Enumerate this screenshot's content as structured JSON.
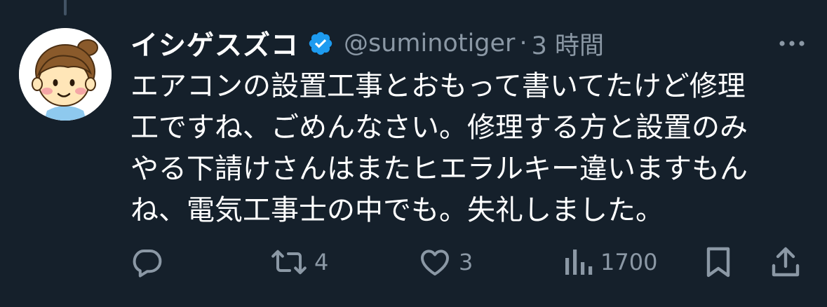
{
  "tweet": {
    "display_name": "イシゲスズコ",
    "verified": true,
    "handle": "@suminotiger",
    "separator": "·",
    "time": "3 時間",
    "text_lines": [
      "エアコンの設置工事とおもって書いてたけど修理",
      "工ですね、ごめんなさい。修理する方と設置のみ",
      "やる下請けさんはまたヒエラルキー違いますもん",
      "ね、電気工事士の中でも。失礼しました。"
    ]
  },
  "actions": {
    "reply": {
      "icon": "reply-icon",
      "count": ""
    },
    "retweet": {
      "icon": "retweet-icon",
      "count": "4"
    },
    "like": {
      "icon": "heart-icon",
      "count": "3"
    },
    "views": {
      "icon": "views-icon",
      "count": "1700"
    },
    "bookmark": {
      "icon": "bookmark-icon"
    },
    "share": {
      "icon": "share-icon"
    }
  },
  "colors": {
    "background": "#15202b",
    "text": "#ffffff",
    "secondary": "#8b98a5",
    "verified": "#1d9bf0",
    "thread_line": "#425364"
  }
}
